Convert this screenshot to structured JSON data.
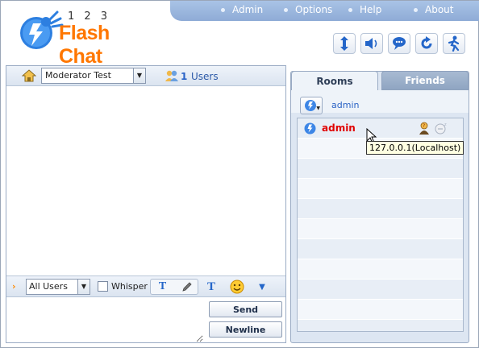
{
  "app": {
    "logo_numbers": "1 2 3",
    "logo_text": "Flash Chat",
    "brand_color": "#ff7700"
  },
  "topnav": {
    "items": [
      {
        "label": "Admin"
      },
      {
        "label": "Options"
      },
      {
        "label": "Help"
      },
      {
        "label": "About"
      }
    ]
  },
  "toolbar": {
    "icons": [
      "resize-icon",
      "sound-icon",
      "bubble-icon",
      "refresh-icon",
      "exit-icon"
    ]
  },
  "left": {
    "room_select": "Moderator Test",
    "users_count": "1",
    "users_label": "Users",
    "recipient_select": "All Users",
    "whisper_label": "Whisper",
    "send_label": "Send",
    "newline_label": "Newline",
    "message_value": ""
  },
  "right": {
    "tabs": [
      {
        "label": "Rooms"
      },
      {
        "label": "Friends"
      }
    ],
    "room_name": "admin",
    "users": [
      {
        "name": "admin",
        "name_color": "#e00000"
      }
    ],
    "tooltip": "127.0.0.1(Localhost)"
  }
}
